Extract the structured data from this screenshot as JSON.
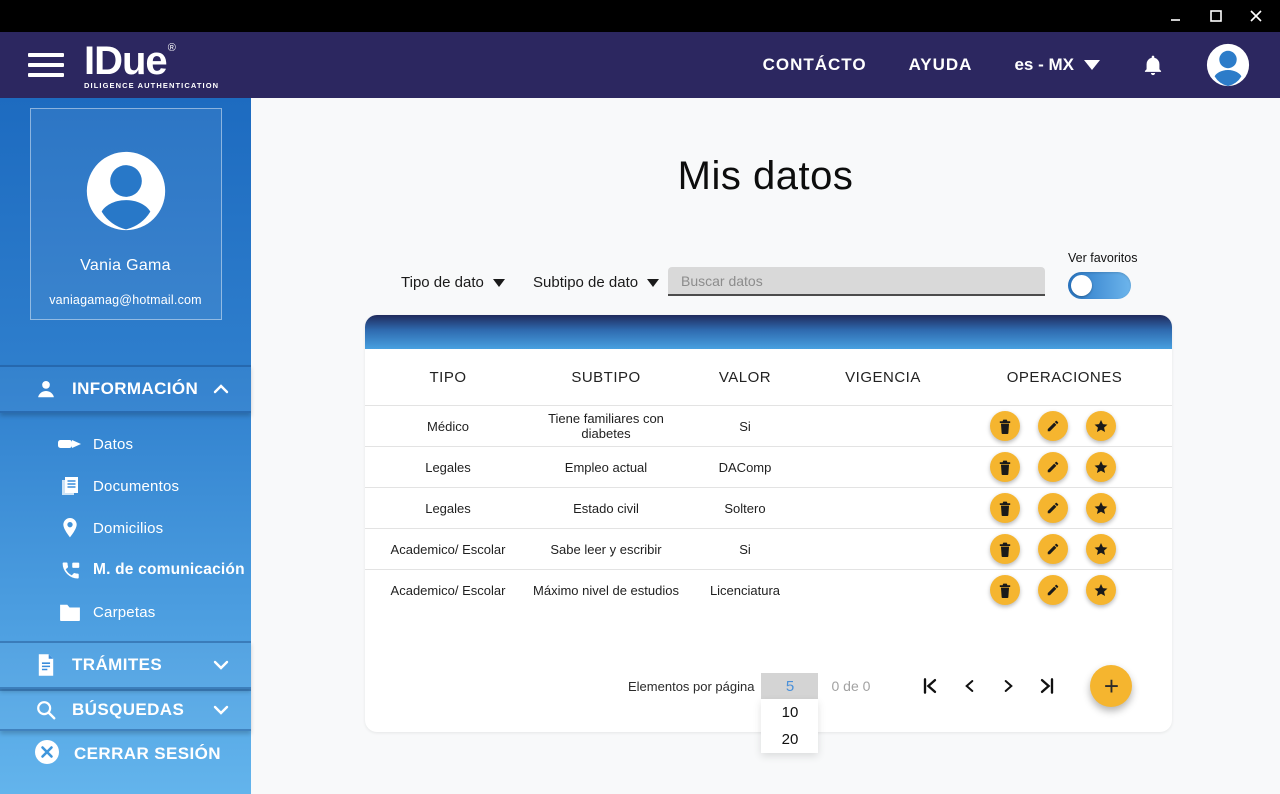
{
  "window": {
    "controls": {
      "minimize": "minimize",
      "maximize": "maximize",
      "close": "close"
    }
  },
  "header": {
    "logo": {
      "title": "IDue",
      "registered": "®",
      "subtitle": "DILIGENCE AUTHENTICATION"
    },
    "nav": {
      "contacto": "CONTÁCTO",
      "ayuda": "AYUDA"
    },
    "language": "es - MX"
  },
  "sidebar": {
    "profile": {
      "name": "Vania Gama",
      "email": "vaniagamag@hotmail.com"
    },
    "informacion": {
      "label": "INFORMACIÓN",
      "expanded": true,
      "items": [
        {
          "label": "Datos",
          "icon": "pen-icon",
          "active": false
        },
        {
          "label": "Documentos",
          "icon": "documents-icon",
          "active": false
        },
        {
          "label": "Domicilios",
          "icon": "location-pin-icon",
          "active": false
        },
        {
          "label": "M. de comunicación",
          "icon": "phone-icon",
          "active": true
        },
        {
          "label": "Carpetas",
          "icon": "folder-icon",
          "active": false
        }
      ]
    },
    "tramites": {
      "label": "TRÁMITES",
      "expanded": false
    },
    "busquedas": {
      "label": "BÚSQUEDAS",
      "expanded": false
    },
    "logout": {
      "label": "CERRAR SESIÓN"
    }
  },
  "main": {
    "title": "Mis datos",
    "filters": {
      "tipo_label": "Tipo de dato",
      "subtipo_label": "Subtipo de dato",
      "search_placeholder": "Buscar datos",
      "favorites_label": "Ver favoritos",
      "favorites_on": false
    },
    "table": {
      "columns": [
        "TIPO",
        "SUBTIPO",
        "VALOR",
        "VIGENCIA",
        "OPERACIONES"
      ],
      "rows": [
        {
          "tipo": "Médico",
          "subtipo": "Tiene familiares con diabetes",
          "valor": "Si",
          "vigencia": ""
        },
        {
          "tipo": "Legales",
          "subtipo": "Empleo actual",
          "valor": "DAComp",
          "vigencia": ""
        },
        {
          "tipo": "Legales",
          "subtipo": "Estado civil",
          "valor": "Soltero",
          "vigencia": ""
        },
        {
          "tipo": "Academico/ Escolar",
          "subtipo": "Sabe leer y escribir",
          "valor": "Si",
          "vigencia": ""
        },
        {
          "tipo": "Academico/ Escolar",
          "subtipo": "Máximo nivel de estudios",
          "valor": "Licenciatura",
          "vigencia": ""
        }
      ],
      "operations": [
        "trash-icon",
        "pencil-icon",
        "star-icon"
      ]
    },
    "pagination": {
      "items_label": "Elementos por página",
      "page_size": "5",
      "options": [
        "10",
        "20"
      ],
      "range": "0 de 0"
    }
  },
  "colors": {
    "accent_orange": "#f5b52f",
    "header_navy": "#2c2760",
    "sidebar_blue_top": "#1d6bc0",
    "sidebar_blue_bottom": "#63b4ec",
    "selected_page_size": "#4a90d9"
  }
}
